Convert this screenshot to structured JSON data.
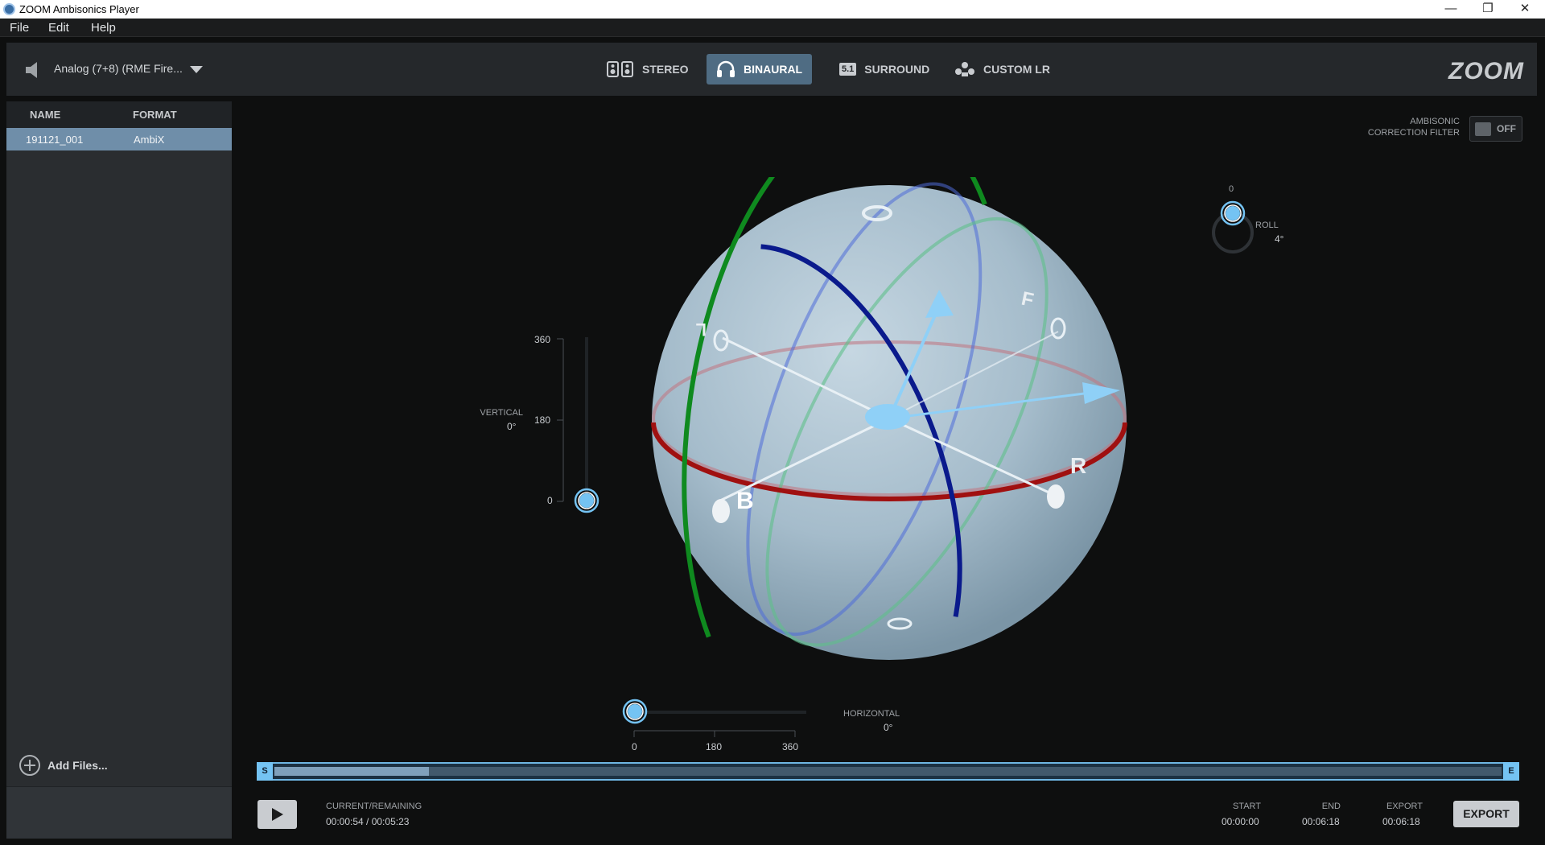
{
  "window": {
    "title": "ZOOM Ambisonics Player",
    "controls": {
      "minimize": "—",
      "restore": "❐",
      "close": "✕"
    }
  },
  "menu": [
    "File",
    "Edit",
    "Help"
  ],
  "toolbar": {
    "device": "Analog (7+8) (RME Fire...",
    "modes": [
      {
        "label": "STEREO",
        "icon": "stereo-speakers-icon",
        "active": false
      },
      {
        "label": "BINAURAL",
        "icon": "headphones-icon",
        "active": true
      },
      {
        "label": "SURROUND",
        "icon": "surround-5-1-icon",
        "badge": "5.1",
        "active": false
      },
      {
        "label": "CUSTOM LR",
        "icon": "custom-lr-icon",
        "active": false
      }
    ],
    "logo": "ZOOM"
  },
  "file_list": {
    "headers": [
      "NAME",
      "FORMAT"
    ],
    "rows": [
      {
        "name": "191121_001",
        "format": "AmbiX"
      }
    ],
    "add_files": "Add Files..."
  },
  "correction_filter": {
    "label_line1": "AMBISONIC",
    "label_line2": "CORRECTION FILTER",
    "state": "OFF"
  },
  "roll": {
    "label": "ROLL",
    "value": "4°",
    "top_tick": "0"
  },
  "vertical": {
    "label": "VERTICAL",
    "value": "0°",
    "ticks": [
      "360",
      "180",
      "0"
    ]
  },
  "horizontal": {
    "label": "HORIZONTAL",
    "value": "0°",
    "ticks": [
      "0",
      "180",
      "360"
    ]
  },
  "sphere_labels": {
    "front": "F",
    "back": "B",
    "left": "L",
    "right": "R"
  },
  "timeline": {
    "start_marker": "S",
    "end_marker": "E",
    "progress_fraction": 0.126
  },
  "transport": {
    "current_label": "CURRENT/REMAINING",
    "current_value": "00:00:54 / 00:05:23",
    "start_label": "START",
    "start_value": "00:00:00",
    "end_label": "END",
    "end_value": "00:06:18",
    "export_label": "EXPORT",
    "export_value": "00:06:18",
    "export_button": "EXPORT"
  },
  "colors": {
    "accent": "#74c3f3",
    "active_mode": "#4f6c83",
    "selected_row": "#6f8ea9",
    "ring_red": "#a01010",
    "ring_green": "#0f8a1f",
    "ring_blue": "#0a1a8c"
  }
}
